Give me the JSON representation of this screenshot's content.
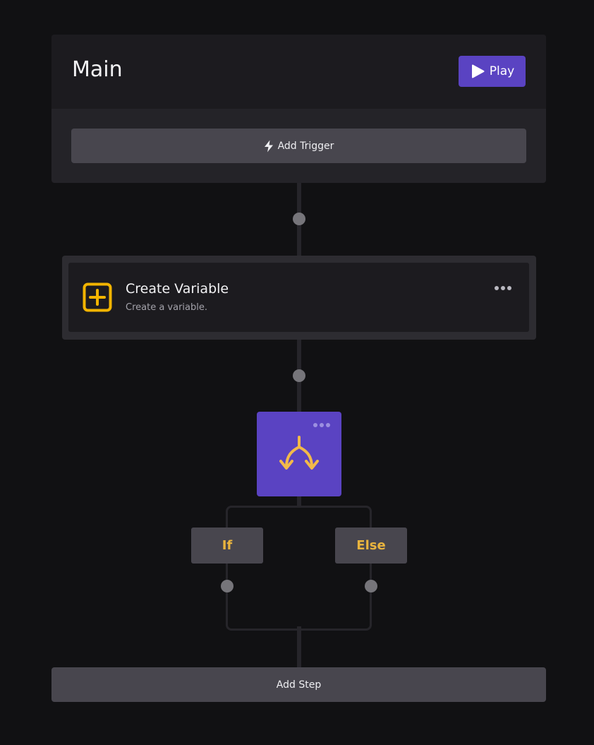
{
  "main": {
    "title": "Main",
    "play_label": "Play",
    "add_trigger_label": "Add Trigger"
  },
  "steps": {
    "create_variable": {
      "title": "Create Variable",
      "description": "Create a variable."
    }
  },
  "branch": {
    "if_label": "If",
    "else_label": "Else"
  },
  "add_step_label": "Add Step",
  "icons": {
    "play": "play-icon",
    "trigger": "lightning-icon",
    "variable": "plus-square-icon",
    "more": "more-horizontal-icon",
    "branch": "split-arrows-icon"
  },
  "colors": {
    "accent": "#5a43c2",
    "variable_icon": "#f2b400",
    "branch_label": "#e9b43e",
    "background": "#111113"
  }
}
